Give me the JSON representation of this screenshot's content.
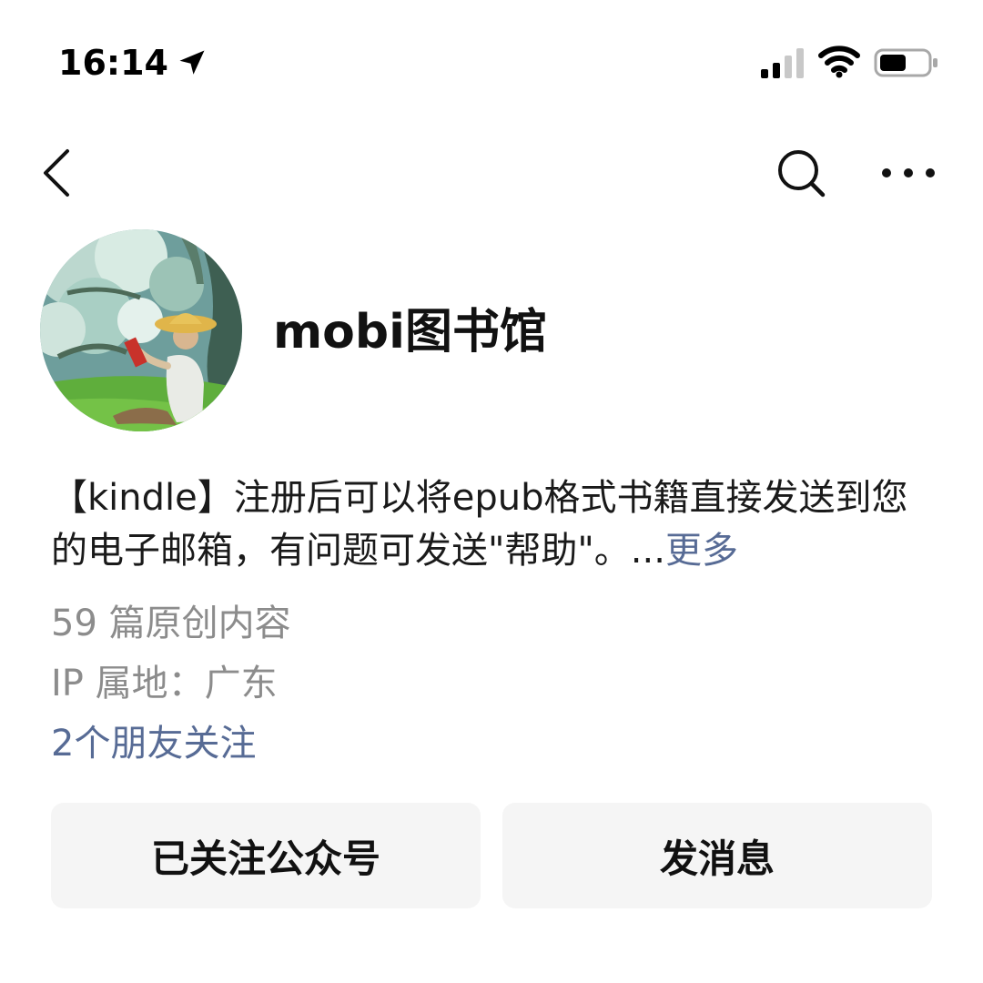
{
  "status_bar": {
    "time": "16:14",
    "icons": [
      "location-arrow-icon",
      "cellular-signal-icon",
      "wifi-icon",
      "battery-icon"
    ]
  },
  "nav": {
    "icons": [
      "back-chevron-icon",
      "search-icon",
      "more-dots-icon"
    ]
  },
  "profile": {
    "name": "mobi图书馆",
    "description": "【kindle】注册后可以将epub格式书籍直接发送到您的电子邮箱，有问题可发送\"帮助\"。...",
    "more_label": "更多",
    "original_articles": "59 篇原创内容",
    "ip_location": "IP 属地：广东",
    "friends_following": "2个朋友关注"
  },
  "actions": {
    "followed_label": "已关注公众号",
    "message_label": "发消息"
  },
  "colors": {
    "link": "#576b95",
    "muted_text": "#8c8c8c",
    "button_bg": "#f5f5f5"
  }
}
